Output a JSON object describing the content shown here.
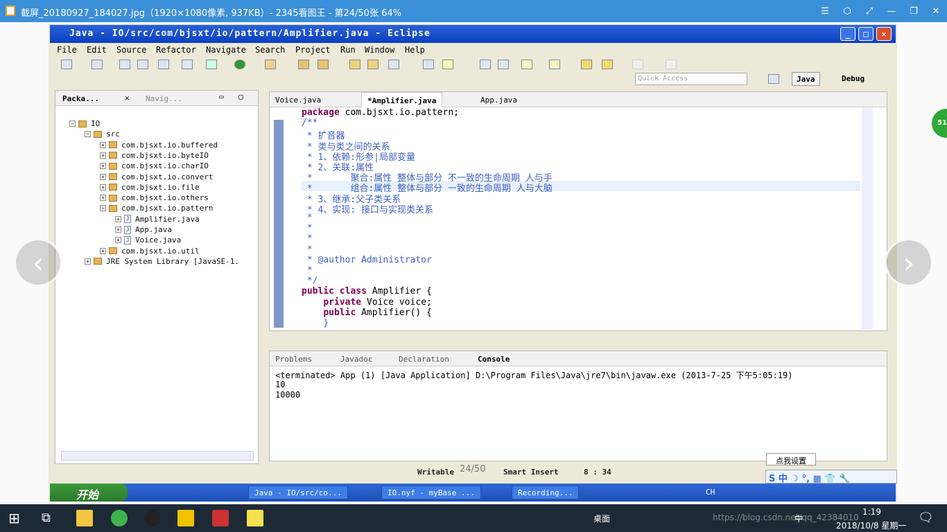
{
  "viewer": {
    "title": "截屏_20180927_184027.jpg（1920×1080像素, 937KB）- 2345看图王 - 第24/50张 64%",
    "page_count": "24/50",
    "badge": "51"
  },
  "eclipse": {
    "title": "Java - IO/src/com/bjsxt/io/pattern/Amplifier.java - Eclipse",
    "menu": [
      "File",
      "Edit",
      "Source",
      "Refactor",
      "Navigate",
      "Search",
      "Project",
      "Run",
      "Window",
      "Help"
    ],
    "quick_access_placeholder": "Quick Access",
    "perspectives": [
      "Java",
      "Debug"
    ],
    "left_tabs": [
      "Packa...",
      "Navig..."
    ],
    "tree": [
      {
        "label": "IO",
        "indent": 0,
        "exp": "−"
      },
      {
        "label": "src",
        "indent": 1,
        "exp": "−"
      },
      {
        "label": "com.bjsxt.io.buffered",
        "indent": 2,
        "exp": "+"
      },
      {
        "label": "com.bjsxt.io.byteIO",
        "indent": 2,
        "exp": "+"
      },
      {
        "label": "com.bjsxt.io.charIO",
        "indent": 2,
        "exp": "+"
      },
      {
        "label": "com.bjsxt.io.convert",
        "indent": 2,
        "exp": "+"
      },
      {
        "label": "com.bjsxt.io.file",
        "indent": 2,
        "exp": "+"
      },
      {
        "label": "com.bjsxt.io.others",
        "indent": 2,
        "exp": "+"
      },
      {
        "label": "com.bjsxt.io.pattern",
        "indent": 2,
        "exp": "−"
      },
      {
        "label": "Amplifier.java",
        "indent": 3,
        "exp": "+"
      },
      {
        "label": "App.java",
        "indent": 3,
        "exp": "+"
      },
      {
        "label": "Voice.java",
        "indent": 3,
        "exp": "+"
      },
      {
        "label": "com.bjsxt.io.util",
        "indent": 2,
        "exp": "+"
      },
      {
        "label": "JRE System Library [JavaSE-1.",
        "indent": 1,
        "exp": "+"
      }
    ],
    "editor_tabs": [
      "Voice.java",
      "*Amplifier.java",
      "App.java"
    ],
    "code": [
      "package com.bjsxt.io.pattern;",
      "/**",
      " * 扩音器",
      " * 类与类之间的关系",
      " * 1、依赖:形参|局部变量",
      " * 2、关联:属性",
      " *       聚合:属性 整体与部分 不一致的生命周期 人与手",
      " *       组合:属性 整体与部分 一致的生命周期 人与大脑",
      " * 3、继承:父子类关系",
      " * 4、实现: 接口与实现类关系",
      " *",
      " *",
      " *",
      " *",
      " * @author Administrator",
      " *",
      " */",
      "public class Amplifier {",
      "    private Voice voice;",
      "    public Amplifier() {",
      "    }"
    ],
    "console_tabs": [
      "Problems",
      "Javadoc",
      "Declaration",
      "Console"
    ],
    "console_lines": [
      "<terminated> App (1) [Java Application] D:\\Program Files\\Java\\jre7\\bin\\javaw.exe (2013-7-25 下午5:05:19)",
      "10",
      "10000"
    ],
    "status": {
      "writable": "Writable",
      "insert": "Smart Insert",
      "pos": "8 : 34"
    },
    "xp_taskbar": {
      "start": "开始",
      "items": [
        "Java - IO/src/co...",
        "IO.nyf - myBase ...",
        "Recording..."
      ],
      "tray": "CH",
      "ime_tip": "点我设置",
      "ime_bar": "S 中 ☽ °, ▦ 👕 🔧"
    }
  },
  "windows": {
    "tray_desktop": "桌面",
    "tray_ime": "中",
    "clock_time": "1:19",
    "clock_date": "2018/10/8 星期一",
    "watermark": "https://blog.csdn.net/qq_42384010"
  },
  "colors": {
    "viewer_title": "#3b8fd8",
    "win_taskbar": "#1d2a36",
    "xp_blue": "#1d4fb8"
  }
}
